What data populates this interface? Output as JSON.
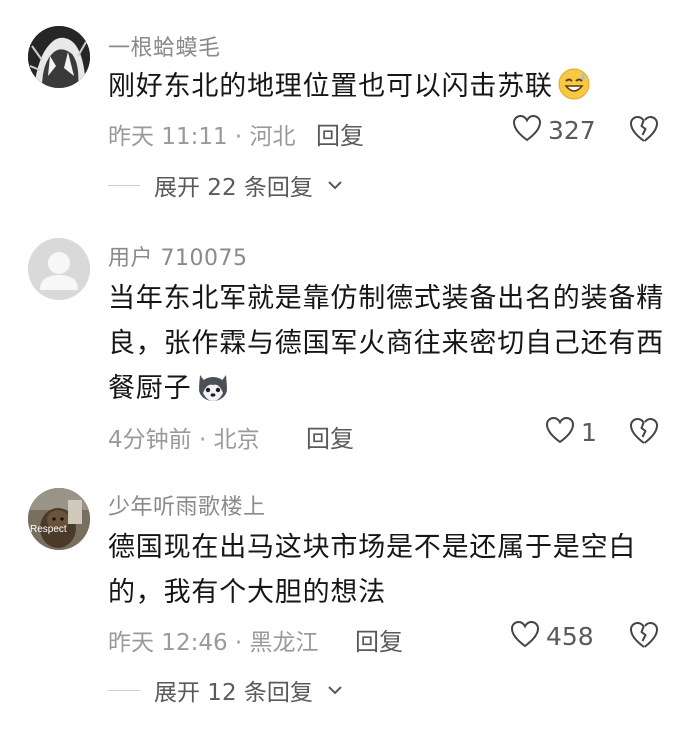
{
  "comments": [
    {
      "username": "一根蛤蟆毛",
      "text": "刚好东北的地理位置也可以闪击苏联",
      "emoji": "grinning-sweat-emoji",
      "meta": "昨天 11:11 · 河北",
      "reply_label": "回复",
      "likes": "327",
      "expand_label": "展开 22 条回复"
    },
    {
      "username": "用户 710075",
      "text": "当年东北军就是靠仿制德式装备出名的装备精良，张作霖与德国军火商往来密切自己还有西餐厨子",
      "emoji": "husky-emoji",
      "meta": "4分钟前 · 北京",
      "reply_label": "回复",
      "likes": "1"
    },
    {
      "username": "少年听雨歌楼上",
      "avatar_text": "Respect",
      "text": "德国现在出马这块市场是不是还属于是空白的，我有个大胆的想法",
      "meta": "昨天 12:46 · 黑龙江",
      "reply_label": "回复",
      "likes": "458",
      "expand_label": "展开 12 条回复"
    }
  ]
}
